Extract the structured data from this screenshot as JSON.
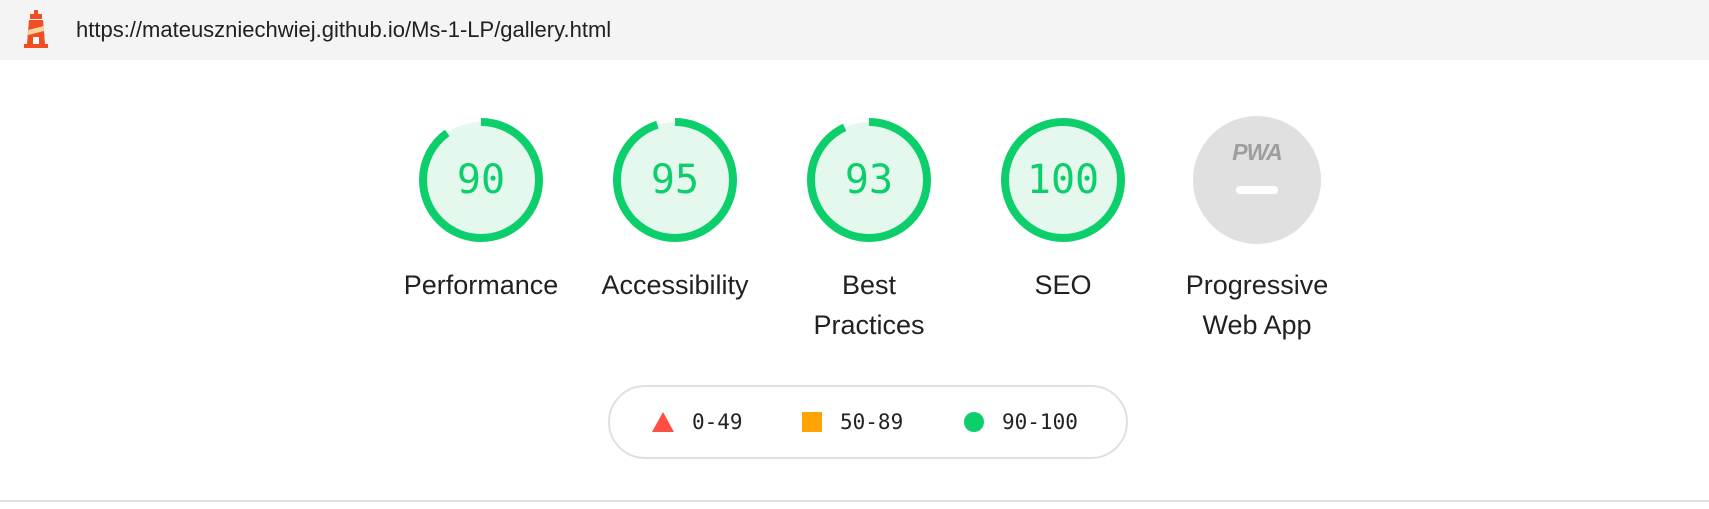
{
  "header": {
    "url": "https://mateuszniechwiej.github.io/Ms-1-LP/gallery.html",
    "icon": "lighthouse-icon"
  },
  "gauges": [
    {
      "label_lines": [
        "Performance"
      ],
      "score": 90,
      "score_text": "90"
    },
    {
      "label_lines": [
        "Accessibility"
      ],
      "score": 95,
      "score_text": "95"
    },
    {
      "label_lines": [
        "Best",
        "Practices"
      ],
      "score": 93,
      "score_text": "93"
    },
    {
      "label_lines": [
        "SEO"
      ],
      "score": 100,
      "score_text": "100"
    },
    {
      "label_lines": [
        "Progressive",
        "Web App"
      ],
      "badge": "PWA",
      "icon": "pwa-badge-icon"
    }
  ],
  "legend": [
    {
      "shape": "triangle",
      "range": "0-49",
      "color": "#ff4e42"
    },
    {
      "shape": "square",
      "range": "50-89",
      "color": "#ffa400"
    },
    {
      "shape": "circle",
      "range": "90-100",
      "color": "#0cce6b"
    }
  ],
  "colors": {
    "pass": "#0cce6b",
    "pass_fill": "#e5f8ee",
    "neutral": "#e0e0e0",
    "neutral_text": "#9e9e9e"
  }
}
